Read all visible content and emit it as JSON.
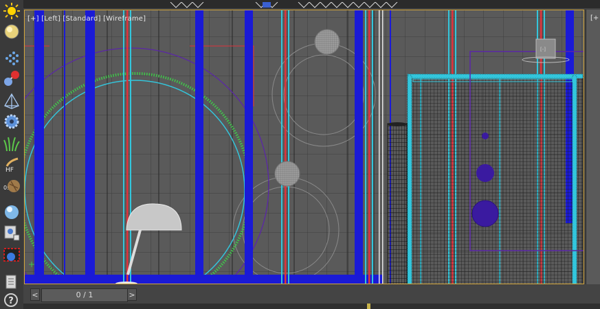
{
  "viewport": {
    "label_parts": [
      "[+]",
      "[Left]",
      "[Standard]",
      "[Wireframe]"
    ],
    "second_viewport_label": "[+"
  },
  "timeline": {
    "frame_counter": "0 / 1",
    "prev_arrow": "<",
    "next_arrow": ">"
  },
  "help": {
    "label": "?"
  },
  "toolbar_icons": [
    "sun-light-icon",
    "sphere-light-icon",
    "particles-icon",
    "molecule-icon",
    "pyramid-mesh-icon",
    "gear-icon",
    "grass-icon",
    "hair-fur-icon",
    "texture-icon",
    "glass-sphere-icon",
    "render-setup-icon",
    "render-frame-icon",
    "document-icon",
    "help-icon"
  ],
  "colors": {
    "viewport_bg": "#5a5a5a",
    "viewport_border": "#d4a63a",
    "wire_blue": "#1a1ad6",
    "wire_cyan": "#33c6dc",
    "wire_red": "#e0323c",
    "wire_green": "#3fc84a",
    "wire_purple": "#5a26a8"
  }
}
